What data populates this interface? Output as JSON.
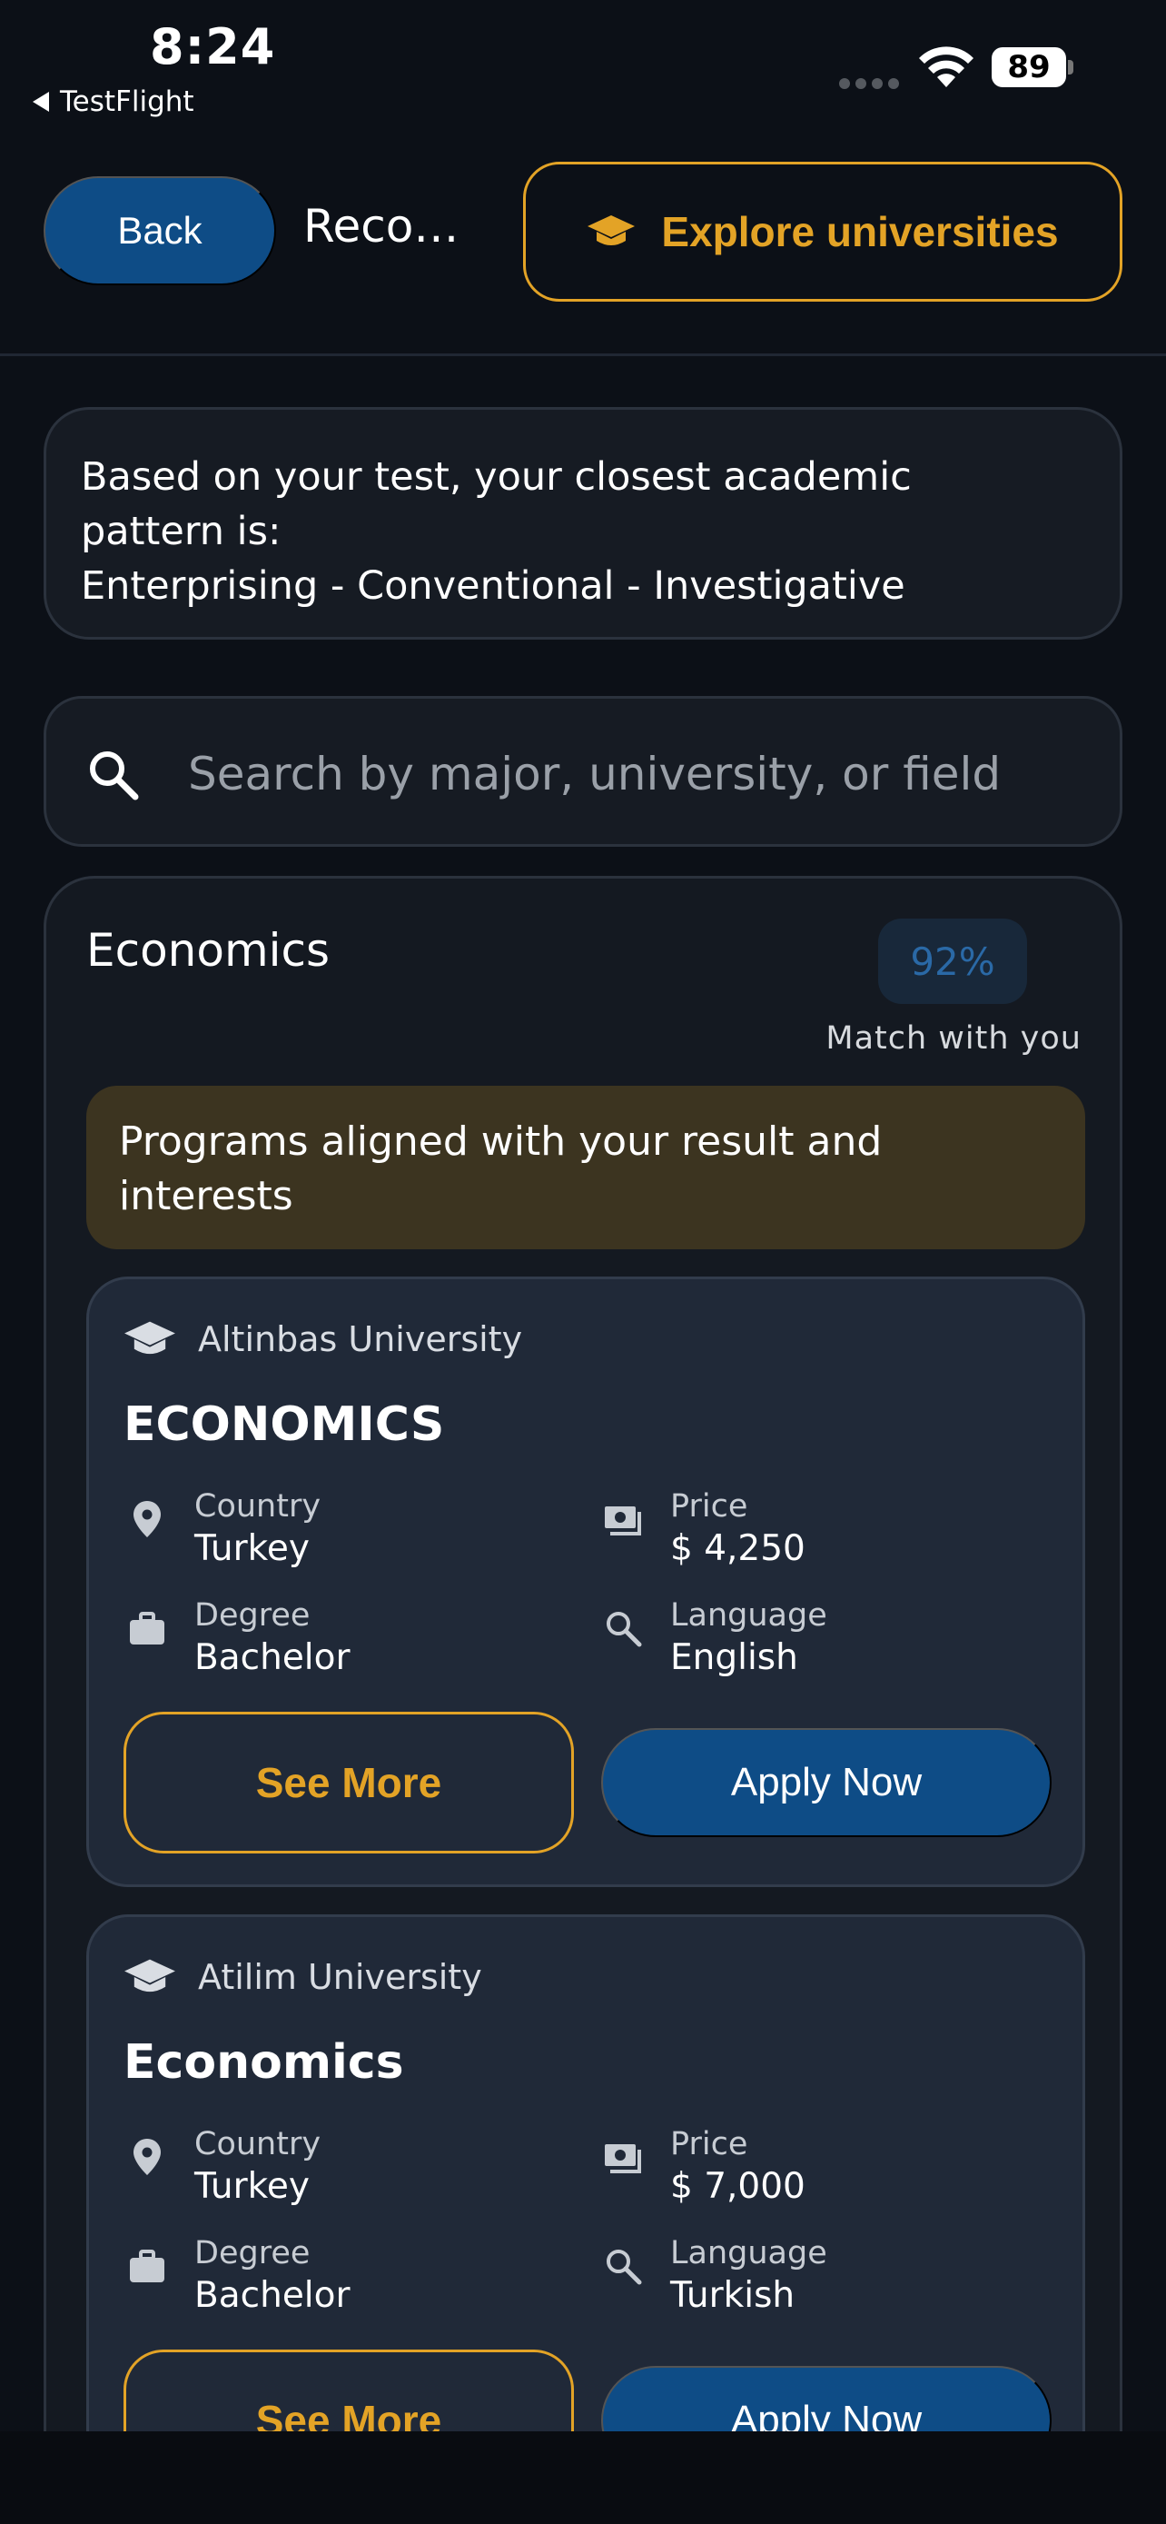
{
  "status_bar": {
    "time": "8:24",
    "back_app": "TestFlight",
    "battery": "89"
  },
  "header": {
    "back_label": "Back",
    "title": "Recommendations",
    "explore_label": "Explore universities"
  },
  "pattern": {
    "line1": "Based on your test, your closest academic",
    "line2": "pattern is:",
    "line3": "Enterprising - Conventional - Investigative"
  },
  "search": {
    "placeholder": "Search by major, university, or field",
    "value": ""
  },
  "major": {
    "title": "Economics",
    "match": "92%",
    "match_label": "Match with you",
    "aligned_text": "Programs aligned with your result and interests",
    "universities": [
      {
        "name": "Altinbas University",
        "program": "ECONOMICS",
        "country_label": "Country",
        "country": "Turkey",
        "price_label": "Price",
        "price": "$ 4,250",
        "degree_label": "Degree",
        "degree": "Bachelor",
        "language_label": "Language",
        "language": "English",
        "see_more": "See More",
        "apply": "Apply Now"
      },
      {
        "name": "Atilim University",
        "program": "Economics",
        "country_label": "Country",
        "country": "Turkey",
        "price_label": "Price",
        "price": "$ 7,000",
        "degree_label": "Degree",
        "degree": "Bachelor",
        "language_label": "Language",
        "language": "Turkish",
        "see_more": "See More",
        "apply": "Apply Now"
      }
    ]
  },
  "icons": {
    "graduation": "graduation-cap-icon",
    "location": "location-pin-icon",
    "price": "money-icon",
    "degree": "briefcase-icon",
    "language": "search-icon",
    "search": "search-icon"
  },
  "colors": {
    "accent_gold": "#e3a326",
    "primary_blue": "#0e4c86",
    "background": "#0c1017"
  }
}
